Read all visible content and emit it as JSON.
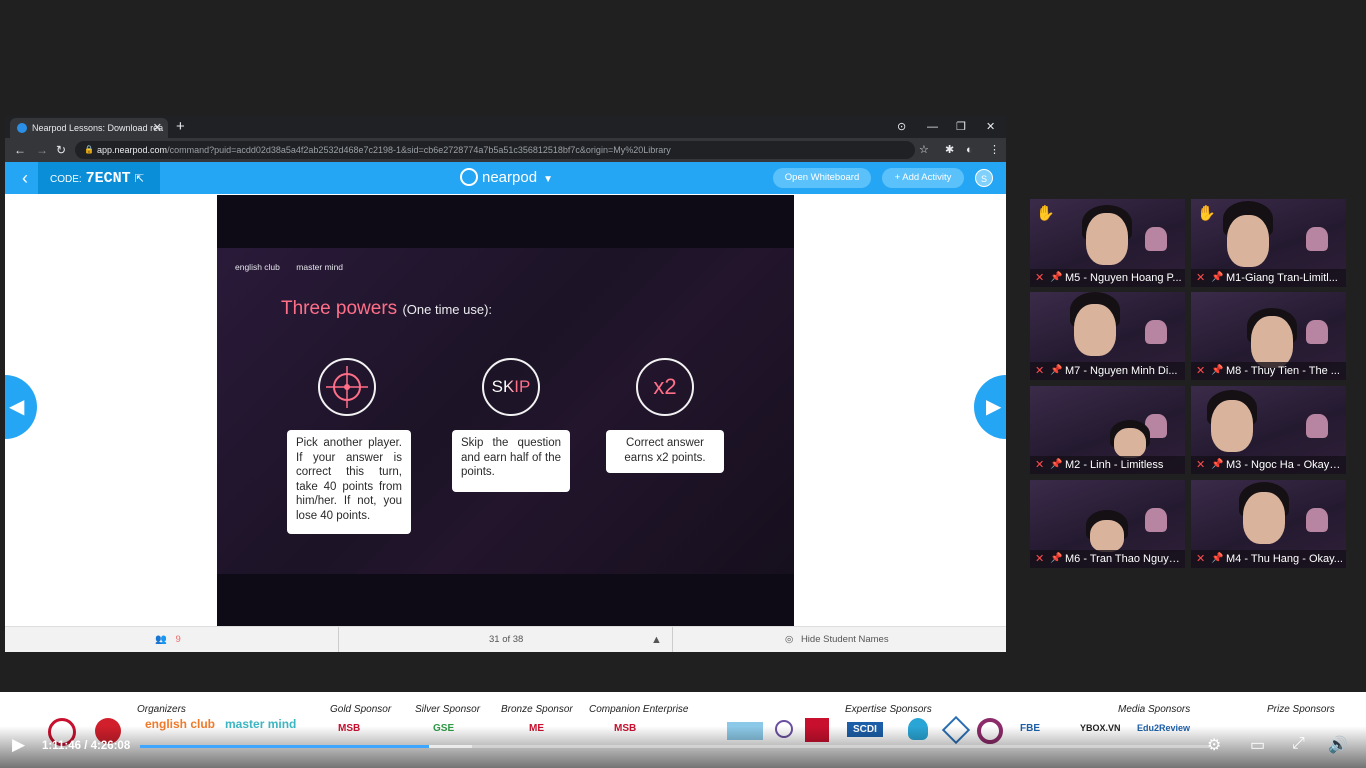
{
  "browser": {
    "tab_title": "Nearpod Lessons: Download rea",
    "tab_close": "✕",
    "new_tab": "+",
    "url_host": "app.nearpod.com",
    "url_path": "/command?puid=acdd02d38a5a4f2ab2532d468e7c2198-1&sid=cb6e2728774a7b5a51c356812518bf7c&origin=My%20Library",
    "window_controls": [
      "⊙",
      "—",
      "❐",
      "✕"
    ]
  },
  "nearpod": {
    "back_icon": "chevron-left-icon",
    "code_label": "CODE:",
    "code_value": "7ECNT",
    "logo_text": "nearpod",
    "open_whiteboard": "Open Whiteboard",
    "add_activity": "+ Add Activity",
    "user_initial": "S",
    "participants_count": "9",
    "slide_position": "31 of 38",
    "hide_names": "Hide Student Names"
  },
  "slide": {
    "logo1": "english club",
    "logo2": "master mind",
    "title_main": "Three powers",
    "title_sub": "(One time use):",
    "powers": [
      {
        "icon_text": "",
        "icon_name": "crosshair-icon",
        "text": "Pick another player. If your answer is correct this turn, take 40 points from him/her. If not, you lose 40 points."
      },
      {
        "icon_text": "SKIP",
        "icon_name": "skip-icon",
        "text": "Skip the question and earn half of the points."
      },
      {
        "icon_text": "x2",
        "icon_name": "double-icon",
        "text": "Correct answer earns x2 points."
      }
    ]
  },
  "participants": [
    {
      "name": "M5 - Nguyen Hoang P...",
      "raised_hand": true
    },
    {
      "name": "M1-Giang Tran-Limitl...",
      "raised_hand": true
    },
    {
      "name": "M7 - Nguyen Minh Di...",
      "raised_hand": false
    },
    {
      "name": "M8 - Thuy Tien - The ...",
      "raised_hand": false
    },
    {
      "name": "M2 - Linh - Limitless",
      "raised_hand": false
    },
    {
      "name": "M3 - Ngoc Ha - Okay?...",
      "raised_hand": false
    },
    {
      "name": "M6 - Tran Thao Nguye...",
      "raised_hand": false
    },
    {
      "name": "M4 - Thu Hang - Okay...",
      "raised_hand": false
    }
  ],
  "sponsors": {
    "labels": [
      "Organizers",
      "Gold Sponsor",
      "Silver Sponsor",
      "Bronze Sponsor",
      "Companion Enterprise",
      "Expertise Sponsors",
      "Media Sponsors",
      "Prize Sponsors"
    ],
    "logos": [
      "english club",
      "master mind",
      "MSB",
      "GSE",
      "ME",
      "MSB",
      "SCDI",
      "FBE",
      "YBOX.VN",
      "Edu2Review"
    ]
  },
  "player": {
    "time": "1:11:46 / 4:26:08",
    "progress": 0.27,
    "buffered": 0.31
  },
  "colors": {
    "nearpod_blue": "#25a6f5",
    "nearpod_code_bg": "#0b8ed8",
    "accent_pink": "#ff6f88",
    "progress_red": "#3ea6ff"
  }
}
